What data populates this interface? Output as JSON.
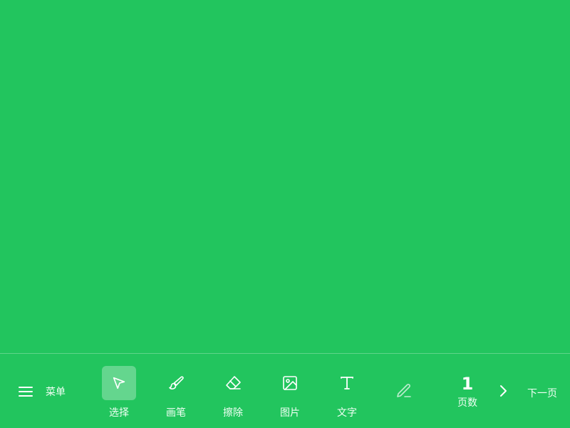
{
  "colors": {
    "background": "#22c55e",
    "foreground": "#ffffff",
    "active_tool_bg": "rgba(255,255,255,0.3)"
  },
  "menu": {
    "label": "菜单",
    "icon": "hamburger-menu-icon"
  },
  "tools": [
    {
      "id": "select",
      "label": "选择",
      "icon": "cursor-arrow-icon",
      "active": true
    },
    {
      "id": "brush",
      "label": "画笔",
      "icon": "brush-icon",
      "active": false
    },
    {
      "id": "erase",
      "label": "擦除",
      "icon": "eraser-icon",
      "active": false
    },
    {
      "id": "image",
      "label": "图片",
      "icon": "image-icon",
      "active": false
    },
    {
      "id": "text",
      "label": "文字",
      "icon": "text-icon",
      "active": false
    }
  ],
  "pen_tool": {
    "icon": "pen-icon"
  },
  "page": {
    "number": "1",
    "label": "页数"
  },
  "next_page": {
    "label": "下一页",
    "icon": "chevron-right-icon"
  }
}
